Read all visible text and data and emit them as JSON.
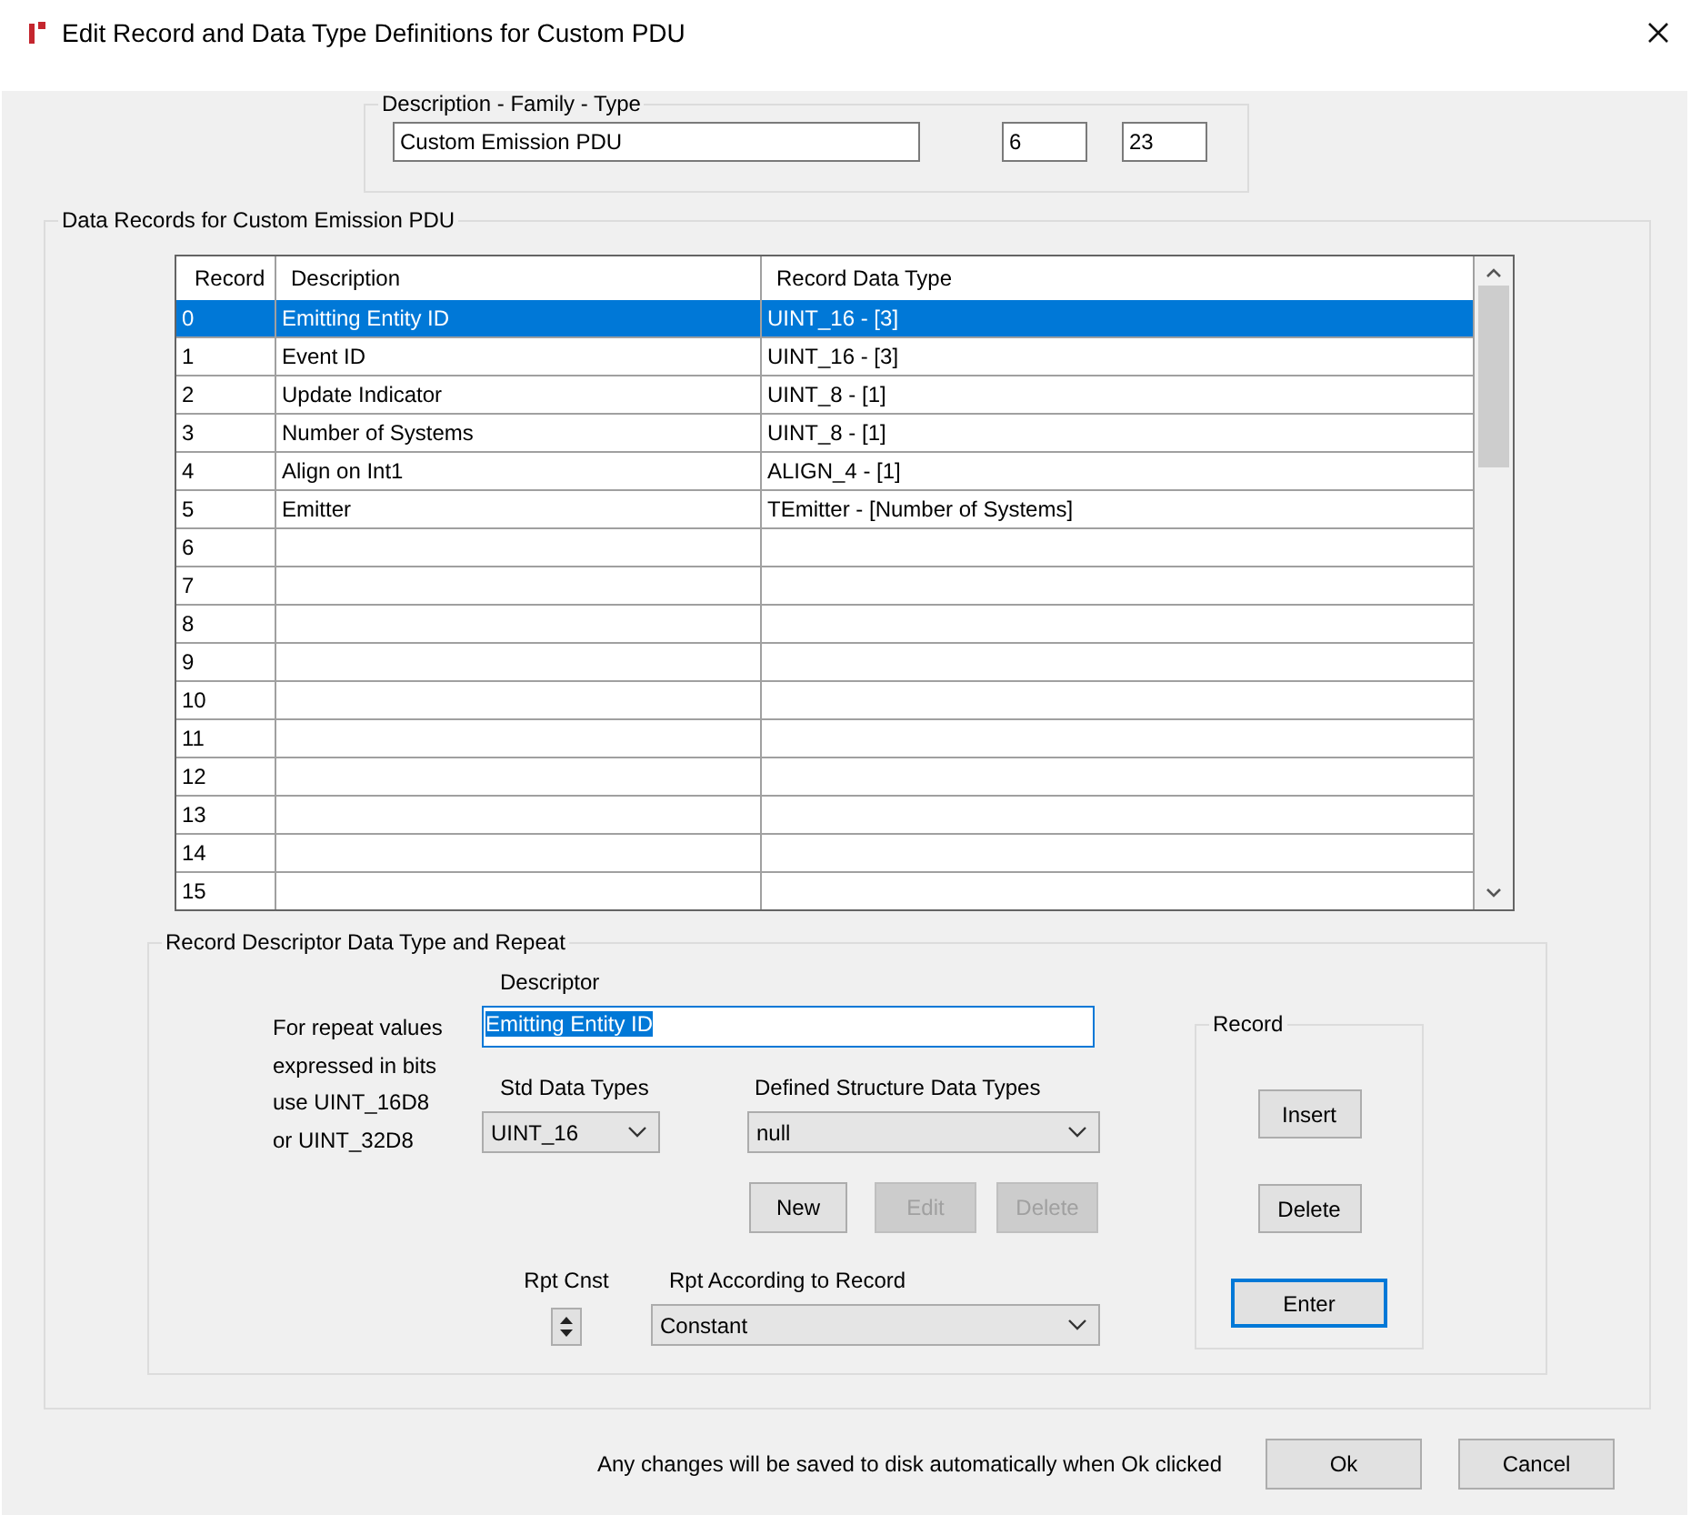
{
  "window": {
    "title": "Edit Record and Data Type Definitions for Custom PDU"
  },
  "header_group": {
    "legend": "Description - Family - Type",
    "description": "Custom Emission PDU",
    "family": "6",
    "type": "23"
  },
  "records_group": {
    "legend": "Data Records for Custom Emission PDU",
    "table": {
      "columns": [
        "Record",
        "Description",
        "Record Data Type"
      ],
      "rows": [
        {
          "cells": [
            "0",
            "Emitting Entity ID",
            "UINT_16 - [3]"
          ],
          "selected": true
        },
        {
          "cells": [
            "1",
            "Event ID",
            "UINT_16 - [3]"
          ],
          "selected": false
        },
        {
          "cells": [
            "2",
            "Update Indicator",
            "UINT_8 - [1]"
          ],
          "selected": false
        },
        {
          "cells": [
            "3",
            "Number of Systems",
            "UINT_8 - [1]"
          ],
          "selected": false
        },
        {
          "cells": [
            "4",
            "Align on Int1",
            "ALIGN_4 - [1]"
          ],
          "selected": false
        },
        {
          "cells": [
            "5",
            "Emitter",
            "TEmitter - [Number of Systems]"
          ],
          "selected": false
        },
        {
          "cells": [
            "6"
          ],
          "selected": false
        },
        {
          "cells": [
            "7"
          ],
          "selected": false
        },
        {
          "cells": [
            "8"
          ],
          "selected": false
        },
        {
          "cells": [
            "9"
          ],
          "selected": false
        },
        {
          "cells": [
            "10"
          ],
          "selected": false
        },
        {
          "cells": [
            "11"
          ],
          "selected": false
        },
        {
          "cells": [
            "12"
          ],
          "selected": false
        },
        {
          "cells": [
            "13"
          ],
          "selected": false
        },
        {
          "cells": [
            "14"
          ],
          "selected": false
        },
        {
          "cells": [
            "15"
          ],
          "selected": false
        }
      ]
    }
  },
  "descriptor_group": {
    "legend": "Record Descriptor Data Type and Repeat",
    "descriptor": {
      "label": "Descriptor",
      "value": "Emitting Entity ID",
      "text_selected": true
    },
    "note_lines": [
      "For repeat values",
      "expressed in bits",
      "use UINT_16D8",
      "or UINT_32D8"
    ],
    "std_data_types": {
      "label": "Std Data Types",
      "value": "UINT_16"
    },
    "defined_structure_data_types": {
      "label": "Defined Structure Data Types",
      "value": "null"
    },
    "structure_buttons": [
      {
        "label": "New",
        "disabled": false
      },
      {
        "label": "Edit",
        "disabled": true
      },
      {
        "label": "Delete",
        "disabled": true
      }
    ],
    "rpt_cnst": {
      "label": "Rpt Cnst"
    },
    "rpt_according_to_record": {
      "label": "Rpt According to Record",
      "value": "Constant"
    },
    "record_group": {
      "legend": "Record",
      "buttons": [
        {
          "label": "Insert",
          "focused": false
        },
        {
          "label": "Delete",
          "focused": false
        },
        {
          "label": "Enter",
          "focused": true
        }
      ]
    }
  },
  "footer": {
    "note": "Any changes will be saved to disk automatically when Ok clicked",
    "buttons": [
      "Ok",
      "Cancel"
    ]
  }
}
